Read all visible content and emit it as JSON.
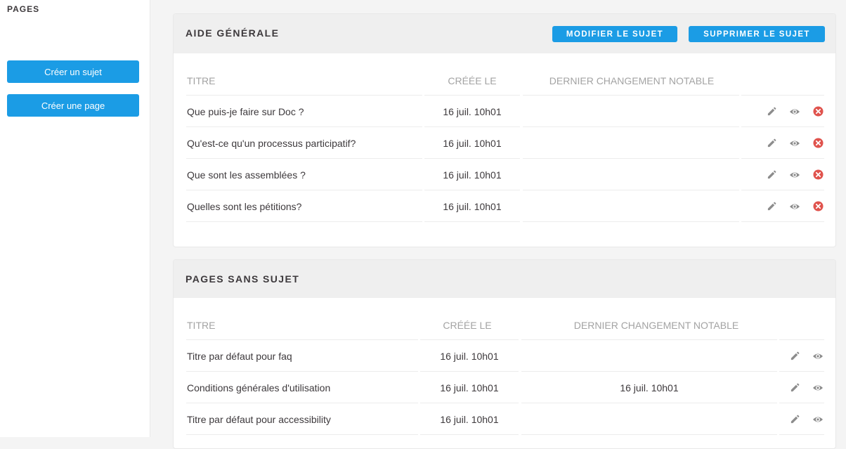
{
  "sidebar": {
    "title": "PAGES",
    "create_topic": "Créer un sujet",
    "create_page": "Créer une page"
  },
  "colors": {
    "primary": "#1b9ce5",
    "danger": "#e0534d",
    "icon": "#8c8c8c"
  },
  "icons": {
    "edit": "pencil-icon",
    "view": "eye-icon",
    "delete": "close-circle-icon"
  },
  "topic": {
    "title": "AIDE GÉNÉRALE",
    "edit_button": "MODIFIER LE SUJET",
    "delete_button": "SUPPRIMER LE SUJET",
    "columns": {
      "title": "TITRE",
      "created": "CRÉÉE LE",
      "changed": "DERNIER CHANGEMENT NOTABLE"
    },
    "rows": [
      {
        "title": "Que puis-je faire sur Doc ?",
        "created": "16 juil. 10h01",
        "changed": ""
      },
      {
        "title": "Qu'est-ce qu'un processus participatif?",
        "created": "16 juil. 10h01",
        "changed": ""
      },
      {
        "title": "Que sont les assemblées ?",
        "created": "16 juil. 10h01",
        "changed": ""
      },
      {
        "title": "Quelles sont les pétitions?",
        "created": "16 juil. 10h01",
        "changed": ""
      }
    ]
  },
  "untopic": {
    "title": "PAGES SANS SUJET",
    "columns": {
      "title": "TITRE",
      "created": "CRÉÉE LE",
      "changed": "DERNIER CHANGEMENT NOTABLE"
    },
    "rows": [
      {
        "title": "Titre par défaut pour faq",
        "created": "16 juil. 10h01",
        "changed": ""
      },
      {
        "title": "Conditions générales d'utilisation",
        "created": "16 juil. 10h01",
        "changed": "16 juil. 10h01"
      },
      {
        "title": "Titre par défaut pour accessibility",
        "created": "16 juil. 10h01",
        "changed": ""
      }
    ]
  }
}
